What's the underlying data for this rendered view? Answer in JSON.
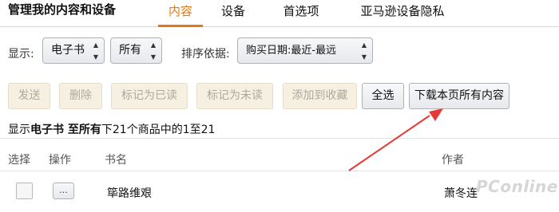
{
  "header": {
    "title": "管理我的内容和设备",
    "tabs": [
      {
        "label": "内容",
        "active": true
      },
      {
        "label": "设备",
        "active": false
      },
      {
        "label": "首选项",
        "active": false
      },
      {
        "label": "亚马逊设备隐私",
        "active": false
      }
    ]
  },
  "filters": {
    "show_label": "显示:",
    "type_select": "电子书",
    "scope_select": "所有",
    "sort_label": "排序依据:",
    "sort_select": "购买日期:最近-最远"
  },
  "actions": {
    "send": "发送",
    "delete": "删除",
    "mark_read": "标记为已读",
    "mark_unread": "标记为未读",
    "add_collection": "添加到收藏",
    "select_all": "全选",
    "download_page": "下载本页所有内容"
  },
  "status": {
    "prefix": "显示",
    "type": "电子书",
    "middle": " 至所有",
    "suffix": "下21个商品中的1至21"
  },
  "table": {
    "columns": {
      "select": "选择",
      "action": "操作",
      "title": "书名",
      "author": "作者"
    },
    "rows": [
      {
        "more": "...",
        "title": "筚路维艰",
        "author": "萧冬连"
      }
    ]
  },
  "annotation": {
    "color": "#e53935"
  },
  "watermark": {
    "text": "PConline"
  },
  "colors": {
    "accent": "#e47911"
  }
}
